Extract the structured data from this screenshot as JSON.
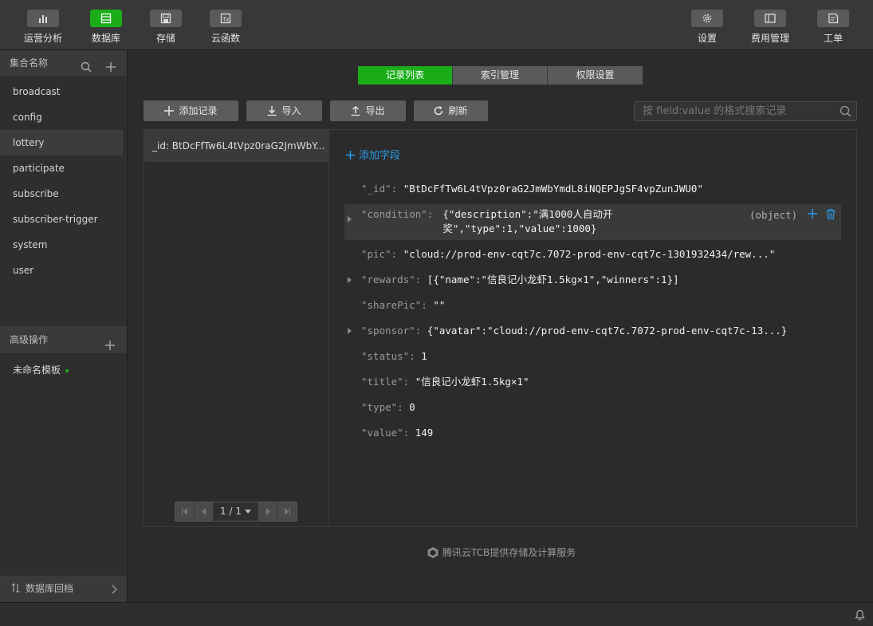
{
  "toolbar": {
    "left": [
      {
        "label": "运营分析",
        "icon": "bar-chart-icon"
      },
      {
        "label": "数据库",
        "icon": "database-icon"
      },
      {
        "label": "存储",
        "icon": "save-icon"
      },
      {
        "label": "云函数",
        "icon": "function-icon"
      }
    ],
    "right": [
      {
        "label": "设置",
        "icon": "gear-icon"
      },
      {
        "label": "费用管理",
        "icon": "billing-icon"
      },
      {
        "label": "工单",
        "icon": "ticket-icon"
      }
    ],
    "active": "数据库"
  },
  "sidebar": {
    "collections_title": "集合名称",
    "collections": [
      "broadcast",
      "config",
      "lottery",
      "participate",
      "subscribe",
      "subscriber-trigger",
      "system",
      "user"
    ],
    "active_collection": "lottery",
    "advanced_title": "高级操作",
    "template_item": "未命名模板",
    "rollback_label": "数据库回档"
  },
  "tabs": [
    {
      "label": "记录列表",
      "active": true
    },
    {
      "label": "索引管理",
      "active": false
    },
    {
      "label": "权限设置",
      "active": false
    }
  ],
  "actions": {
    "add": "添加记录",
    "import": "导入",
    "export": "导出",
    "refresh": "刷新",
    "search_placeholder": "按 field:value 的格式搜索记录"
  },
  "records": {
    "items": [
      "_id: BtDcFfTw6L4tVpz0raG2JmWbY..."
    ],
    "pager": "1 / 1"
  },
  "document": {
    "add_field": "添加字段",
    "fields": [
      {
        "key": "\"_id\":",
        "value": "\"BtDcFfTw6L4tVpz0raG2JmWbYmdL8iNQEPJgSF4vpZunJWU0\""
      },
      {
        "key": "\"condition\":",
        "value": "{\"description\":\"满1000人自动开",
        "value2": "奖\",\"type\":1,\"value\":1000}",
        "type": "(object)"
      },
      {
        "key": "\"pic\":",
        "value": "\"cloud://prod-env-cqt7c.7072-prod-env-cqt7c-1301932434/rew...\""
      },
      {
        "key": "\"rewards\":",
        "value": "[{\"name\":\"信良记小龙虾1.5kg×1\",\"winners\":1}]"
      },
      {
        "key": "\"sharePic\":",
        "value": "\"\""
      },
      {
        "key": "\"sponsor\":",
        "value": "{\"avatar\":\"cloud://prod-env-cqt7c.7072-prod-env-cqt7c-13...}"
      },
      {
        "key": "\"status\":",
        "value": "1"
      },
      {
        "key": "\"title\":",
        "value": "\"信良记小龙虾1.5kg×1\""
      },
      {
        "key": "\"type\":",
        "value": "0"
      },
      {
        "key": "\"value\":",
        "value": "149"
      }
    ]
  },
  "footer_note": "腾讯云TCB提供存储及计算服务",
  "colors": {
    "accent": "#1aad19",
    "link": "#2a9bea"
  }
}
